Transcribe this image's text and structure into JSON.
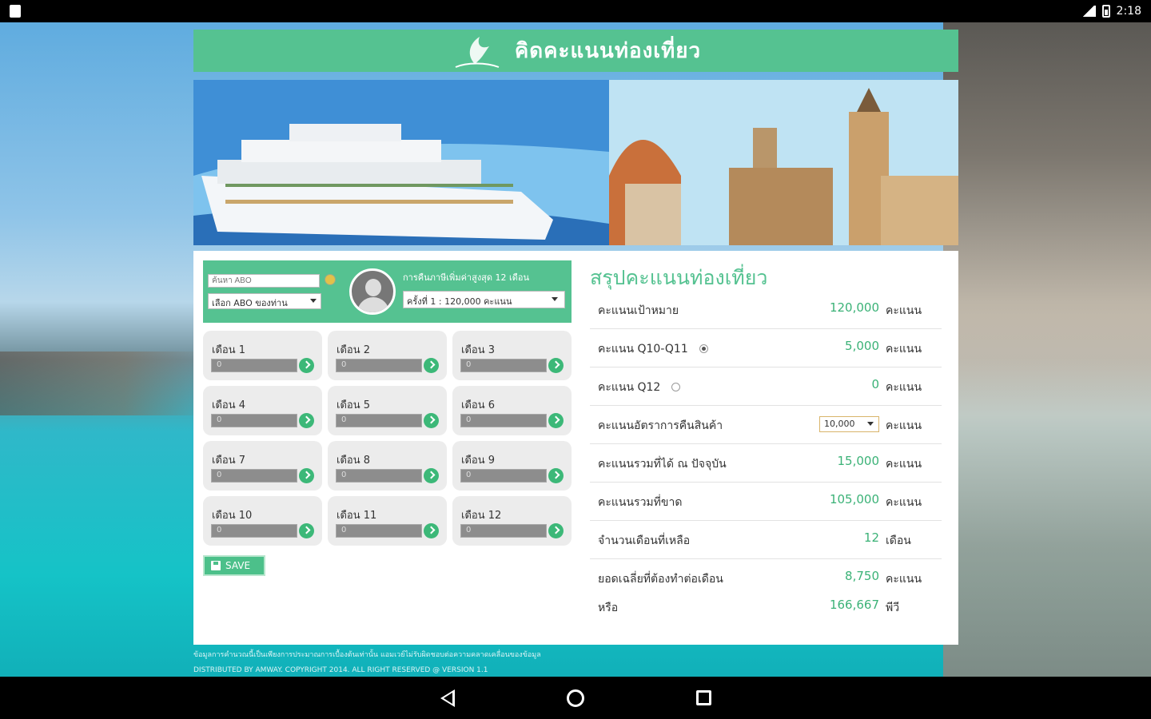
{
  "status_bar": {
    "time": "2:18"
  },
  "app": {
    "title": "คิดคะแนนท่องเที่ยว"
  },
  "abo": {
    "input_placeholder": "ค้นหา ABO",
    "select_value": "เลือก ABO ของท่าน"
  },
  "round": {
    "label": "การคืนภาษีเพิ่มค่าสูงสุด 12 เดือน",
    "select_value": "ครั้งที่ 1 : 120,000 คะแนน"
  },
  "months": [
    {
      "label": "เดือน 1",
      "value": "0"
    },
    {
      "label": "เดือน 2",
      "value": "0"
    },
    {
      "label": "เดือน 3",
      "value": "0"
    },
    {
      "label": "เดือน 4",
      "value": "0"
    },
    {
      "label": "เดือน 5",
      "value": "0"
    },
    {
      "label": "เดือน 6",
      "value": "0"
    },
    {
      "label": "เดือน 7",
      "value": "0"
    },
    {
      "label": "เดือน 8",
      "value": "0"
    },
    {
      "label": "เดือน 9",
      "value": "0"
    },
    {
      "label": "เดือน 10",
      "value": "0"
    },
    {
      "label": "เดือน 11",
      "value": "0"
    },
    {
      "label": "เดือน 12",
      "value": "0"
    }
  ],
  "save_label": "SAVE",
  "summary": {
    "title": "สรุปคะแนนท่องเที่ยว",
    "rows": [
      {
        "label": "คะแนนเป้าหมาย",
        "value": "120,000",
        "unit": "คะแนน"
      },
      {
        "label": "คะแนน Q10-Q11",
        "value": "5,000",
        "unit": "คะแนน",
        "radio": "on"
      },
      {
        "label": "คะแนน Q12",
        "value": "0",
        "unit": "คะแนน",
        "radio": "off"
      },
      {
        "label": "คะแนนอัตราการคืนสินค้า",
        "value": "10,000",
        "unit": "คะแนน"
      },
      {
        "label": "คะแนนรวมที่ได้ ณ ปัจจุบัน",
        "value": "15,000",
        "unit": "คะแนน"
      },
      {
        "label": "คะแนนรวมที่ขาด",
        "value": "105,000",
        "unit": "คะแนน"
      },
      {
        "label": "จำนวนเดือนที่เหลือ",
        "value": "12",
        "unit": "เดือน"
      },
      {
        "label": "ยอดเฉลี่ยที่ต้องทำต่อเดือน",
        "value": "8,750",
        "unit": "คะแนน",
        "label2": "หรือ",
        "value2": "166,667",
        "unit2": "พีวี"
      }
    ]
  },
  "footer": {
    "line1": "ข้อมูลการคำนวณนี้เป็นเพียงการประมาณการเบื้องต้นเท่านั้น แอมเวย์ไม่รับผิดชอบต่อความคลาดเคลื่อนของข้อมูล",
    "line2": "DISTRIBUTED BY AMWAY. COPYRIGHT 2014. ALL RIGHT RESERVED @ VERSION 1.1"
  }
}
